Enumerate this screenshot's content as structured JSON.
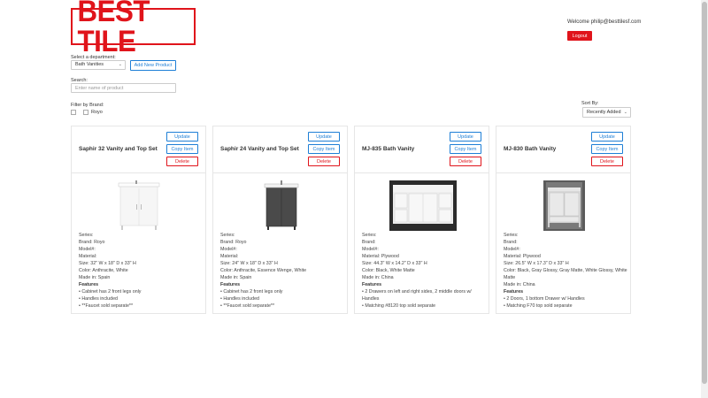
{
  "header": {
    "logo_text": "BEST TILE",
    "welcome": "Welcome philip@besttilesf.com",
    "logout_label": "Logout"
  },
  "filters": {
    "department_label": "Select a department:",
    "department_value": "Bath Vanities",
    "add_product_label": "Add New Product",
    "search_label": "Search:",
    "search_placeholder": "Enter name of product",
    "brand_label": "Filter by Brand:",
    "brand_option": "Royo",
    "sort_label": "Sort By:",
    "sort_value": "Recently Added"
  },
  "card_actions": {
    "update": "Update",
    "copy": "Copy Item",
    "delete": "Delete"
  },
  "features_heading": "Features",
  "products": [
    {
      "title": "Saphir 32 Vanity and Top Set",
      "image": "white-vanity",
      "series": "Series:",
      "brand": "Brand: Royo",
      "model": "Model#:",
      "material": "Material:",
      "size": "Size: 32\" W x 18\" D x 33\" H",
      "color": "Color: Anthracite, White",
      "made_in": "Made in: Spain",
      "features": [
        "• Cabinet has 2 front legs only",
        "• Handles included",
        "• **Faucet sold separate**"
      ]
    },
    {
      "title": "Saphir 24 Vanity and Top Set",
      "image": "dark-vanity",
      "series": "Series:",
      "brand": "Brand: Royo",
      "model": "Model#:",
      "material": "Material:",
      "size": "Size: 24\" W x 18\" D x 33\" H",
      "color": "Color: Anthracite, Essence Wenge, White",
      "made_in": "Made in: Spain",
      "features": [
        "• Cabinet has 2 front legs only",
        "• Handles included",
        "• **Faucet sold separate**"
      ]
    },
    {
      "title": "MJ-835 Bath Vanity",
      "image": "wide-white-vanity",
      "series": "Series:",
      "brand": "Brand:",
      "model": "Model#:",
      "material": "Material: Plywood",
      "size": "Size: 44.3\" W x 14.2\" D x 33\" H",
      "color": "Color: Black, White Matte",
      "made_in": "Made in: China",
      "features": [
        "• 2 Drawers on left and right sides, 2 middle doors w/ Handles",
        "• Matching #8120 top sold separate"
      ]
    },
    {
      "title": "MJ-830 Bath Vanity",
      "image": "white-vanity-photo",
      "series": "Series:",
      "brand": "Brand:",
      "model": "Model#:",
      "material": "Material: Plywood",
      "size": "Size: 26.5\" W x 17.3\" D x 33\" H",
      "color": "Color: Black, Gray Glossy, Gray Matte, White Glossy, White Matte",
      "made_in": "Made in: China",
      "features": [
        "• 2 Doors, 1 bottom Drawer w/ Handles",
        "• Matching F70 top sold separate"
      ]
    }
  ],
  "colors": {
    "brand_red": "#e0141b",
    "primary_blue": "#1e7fd6"
  }
}
